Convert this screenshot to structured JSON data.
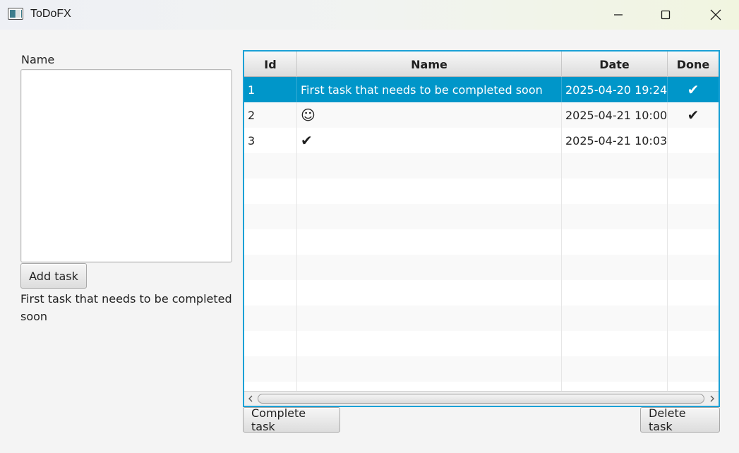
{
  "window": {
    "title": "ToDoFX"
  },
  "form": {
    "name_label": "Name",
    "name_value": "",
    "add_button": "Add task",
    "selected_text": "First task that needs to be completed soon"
  },
  "table": {
    "columns": [
      "Id",
      "Name",
      "Date",
      "Done"
    ],
    "rows": [
      {
        "id": "1",
        "name": "First task that needs to be completed soon",
        "date": "2025-04-20 19:24",
        "done": "✔"
      },
      {
        "id": "2",
        "name": "☺",
        "date": "2025-04-21 10:00",
        "done": "✔"
      },
      {
        "id": "3",
        "name": "✔",
        "date": "2025-04-21 10:03",
        "done": ""
      }
    ],
    "selected_row": 1
  },
  "actions": {
    "complete_button": "Complete task",
    "delete_button": "Delete task"
  },
  "colors": {
    "selection": "#0096c9",
    "focus_border": "#1ba1d6"
  }
}
